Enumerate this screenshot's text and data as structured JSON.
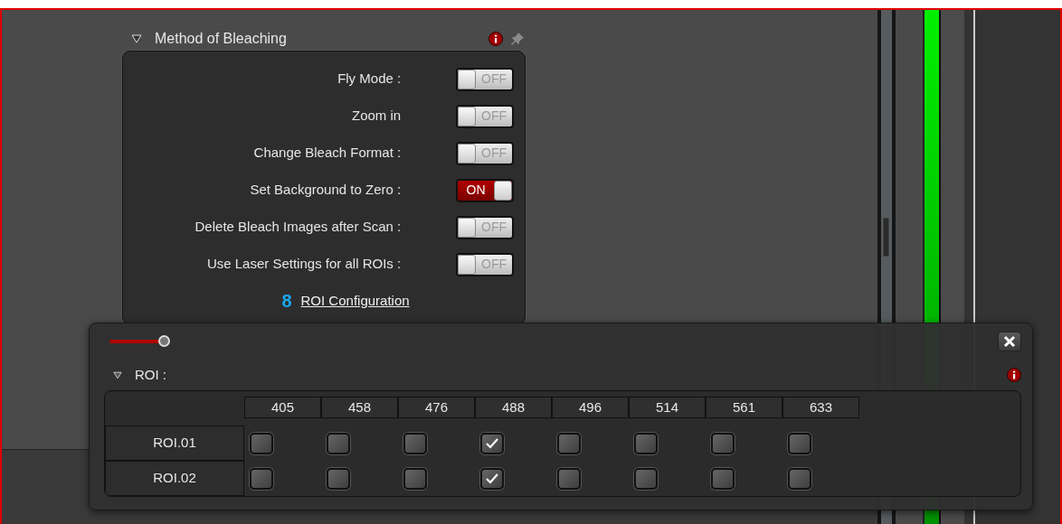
{
  "bleaching": {
    "title": "Method of Bleaching",
    "expanded": true,
    "options": [
      {
        "label": "Fly Mode :",
        "on": false,
        "state_text": "OFF"
      },
      {
        "label": "Zoom in",
        "on": false,
        "state_text": "OFF"
      },
      {
        "label": "Change Bleach Format :",
        "on": false,
        "state_text": "OFF"
      },
      {
        "label": "Set Background to Zero :",
        "on": true,
        "state_text": "ON"
      },
      {
        "label": "Delete Bleach Images after Scan :",
        "on": false,
        "state_text": "OFF"
      },
      {
        "label": "Use Laser Settings for all ROIs :",
        "on": false,
        "state_text": "OFF"
      }
    ],
    "link": {
      "glyph": "8",
      "label": "ROI Configuration"
    }
  },
  "roi_dialog": {
    "slider": {
      "level": 1
    },
    "section": {
      "title": "ROI :",
      "expanded": true
    },
    "columns": [
      "405",
      "458",
      "476",
      "488",
      "496",
      "514",
      "561",
      "633"
    ],
    "rows": [
      {
        "label": "ROI.01",
        "cells": [
          {
            "checked": false
          },
          {
            "checked": false
          },
          {
            "checked": false
          },
          {
            "checked": true
          },
          {
            "checked": false
          },
          {
            "checked": false
          },
          {
            "checked": false
          },
          {
            "checked": false
          }
        ]
      },
      {
        "label": "ROI.02",
        "cells": [
          {
            "checked": false
          },
          {
            "checked": false
          },
          {
            "checked": false
          },
          {
            "checked": true
          },
          {
            "checked": false
          },
          {
            "checked": false
          },
          {
            "checked": false
          },
          {
            "checked": false
          }
        ]
      }
    ]
  }
}
